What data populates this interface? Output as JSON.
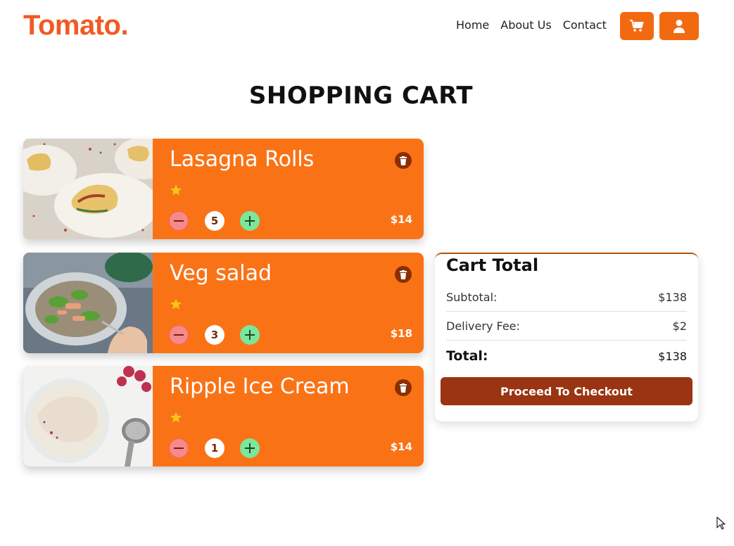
{
  "brand": {
    "logo": "Tomato."
  },
  "nav": {
    "home": "Home",
    "about": "About Us",
    "contact": "Contact"
  },
  "header_buttons": {
    "cart_icon": "cart-icon",
    "user_icon": "user-icon",
    "accent": "#f26a10"
  },
  "page_title": "SHOPPING CART",
  "cart_items": [
    {
      "name": "Lasagna Rolls",
      "rating_stars": 1,
      "quantity": "5",
      "price": "$14"
    },
    {
      "name": "Veg salad",
      "rating_stars": 1,
      "quantity": "3",
      "price": "$18"
    },
    {
      "name": "Ripple Ice Cream",
      "rating_stars": 1,
      "quantity": "1",
      "price": "$14"
    }
  ],
  "cart_total": {
    "heading": "Cart Total",
    "subtotal_label": "Subtotal:",
    "subtotal_value": "$138",
    "delivery_label": "Delivery Fee:",
    "delivery_value": "$2",
    "total_label": "Total:",
    "total_value": "$138",
    "checkout_label": "Proceed To Checkout"
  },
  "colors": {
    "card": "#f97316",
    "checkout": "#9a3412",
    "logo": "#f15a24"
  }
}
